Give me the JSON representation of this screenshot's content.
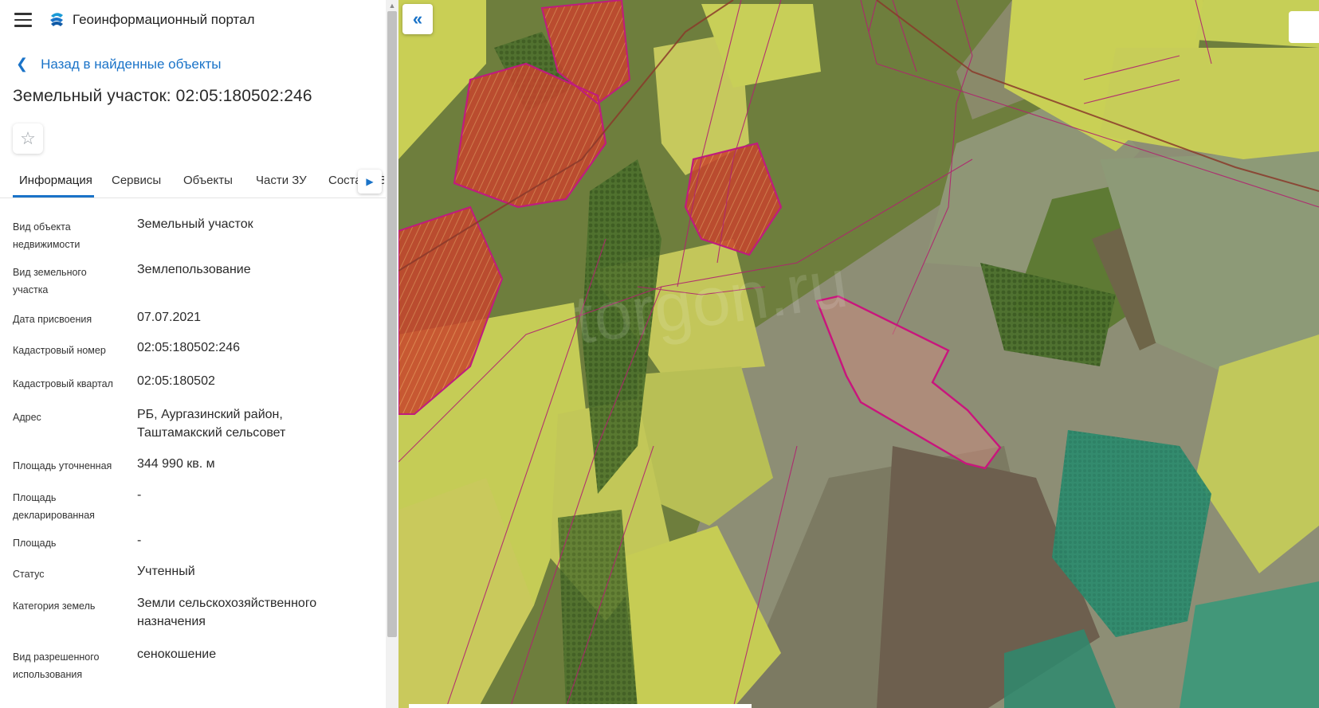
{
  "header": {
    "app_title": "Геоинформационный портал",
    "menu_icon": "hamburger-menu-icon",
    "logo_icon": "portal-logo-icon"
  },
  "back_link": {
    "label": "Назад в найденные объекты",
    "icon": "chevron-left-icon"
  },
  "object_title": "Земельный участок: 02:05:180502:246",
  "favorite_icon": "star-outline-icon",
  "tabs": [
    {
      "label": "Информация",
      "active": true
    },
    {
      "label": "Сервисы",
      "active": false
    },
    {
      "label": "Объекты",
      "active": false
    },
    {
      "label": "Части ЗУ",
      "active": false
    },
    {
      "label": "Состав ЕЗ",
      "active": false
    }
  ],
  "properties": [
    {
      "label": "Вид объекта недвижимости",
      "value": "Земельный участок"
    },
    {
      "label": "Вид земельного участка",
      "value": "Землепользование"
    },
    {
      "label": "Дата присвоения",
      "value": "07.07.2021"
    },
    {
      "label": "Кадастровый номер",
      "value": "02:05:180502:246"
    },
    {
      "label": "Кадастровый квартал",
      "value": "02:05:180502"
    },
    {
      "label": "Адрес",
      "value": "РБ, Аургазинский район, Таштамакский сельсовет"
    },
    {
      "label": "Площадь уточненная",
      "value": "344 990 кв. м"
    },
    {
      "label": "Площадь декларированная",
      "value": "-"
    },
    {
      "label": "Площадь",
      "value": "-"
    },
    {
      "label": "Статус",
      "value": "Учтенный"
    },
    {
      "label": "Категория земель",
      "value": "Земли сельскохозяйственного назначения"
    },
    {
      "label": "Вид разрешенного использования",
      "value": "сенокошение"
    }
  ],
  "map": {
    "watermark": "torgon.ru",
    "collapse_icon": "double-chevron-left-icon",
    "colors": {
      "selected_parcel": "#c9157d",
      "parcel_outline": "#c01b7e",
      "field_yellow": "#c9cf55",
      "field_grey": "#8c9179",
      "forest_teal": "#2e9a79",
      "settlement_red": "#c7432c"
    }
  },
  "colors": {
    "accent": "#1a73c8"
  }
}
